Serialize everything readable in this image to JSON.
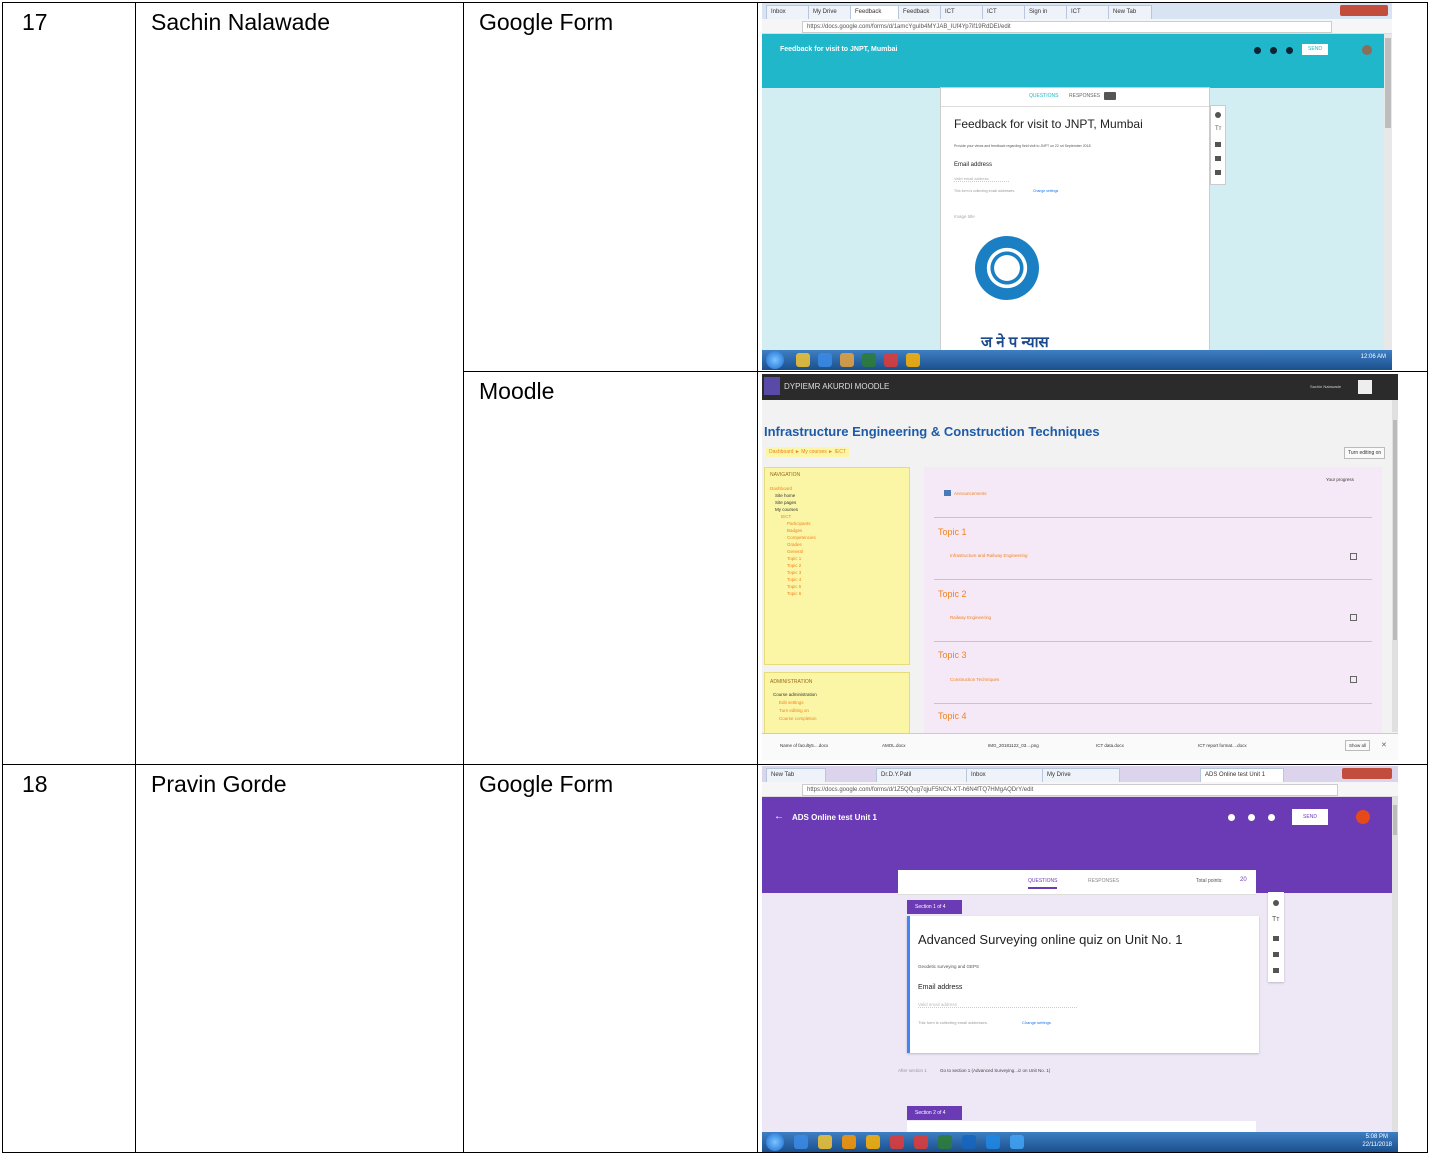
{
  "rows": [
    {
      "sr": "17",
      "name": "Sachin Nalawade",
      "tools": [
        {
          "tool": "Google Form",
          "form_title": "Feedback for visit to JNPT, Mumbai",
          "header_title": "Feedback for visit to JNPT, Mumbai",
          "tab_questions": "QUESTIONS",
          "tab_responses": "RESPONSES",
          "description": "Provide your views and feedback regarding field visit to JNPT on 22 nd September 2018",
          "field_label": "Email address",
          "field_placeholder": "Valid email address",
          "collecting_note": "This form is collecting email addresses.",
          "change_settings": "Change settings",
          "image_title": "Image title",
          "logo_text": "ज ने प न्यास",
          "send_label": "SEND",
          "url": "https://docs.google.com/forms/d/1amcYguIb4MYJAB_IUf4Yp7if19RdDEI/edit",
          "clock": "12:06 AM"
        },
        {
          "tool": "Moodle",
          "site_name": "DYPIEMR AKURDI MOODLE",
          "user_name": "Sachin Nalawade",
          "course_title": "Infrastructure Engineering & Construction Techniques",
          "breadcrumb": "Dashboard ► My courses ► IECT",
          "turn_editing": "Turn editing on",
          "your_progress": "Your progress",
          "announcements": "Announcements",
          "nav_heading": "NAVIGATION",
          "nav_items": [
            "Dashboard",
            "Site home",
            "Site pages",
            "My courses",
            "IECT",
            "Participants",
            "Badges",
            "Competencies",
            "Grades",
            "General",
            "Topic 1",
            "Topic 2",
            "Topic 3",
            "Topic 4",
            "Topic 5",
            "Topic 6"
          ],
          "admin_heading": "ADMINISTRATION",
          "admin_items": [
            "Course administration",
            "Edit settings",
            "Turn editing on",
            "Course completion"
          ],
          "topics": [
            {
              "title": "Topic 1",
              "activity": "Infrastructure and Railway Engineering"
            },
            {
              "title": "Topic 2",
              "activity": "Railway Engineering"
            },
            {
              "title": "Topic 3",
              "activity": "Construction Techniques"
            },
            {
              "title": "Topic 4",
              "activity": ""
            }
          ],
          "downloads": [
            "Name of faculty5....docx",
            "AMOL.docx",
            "IMG_20181122_03....png",
            "ICT data.docx",
            "ICT report format....docx"
          ],
          "show_all": "Show all"
        }
      ]
    },
    {
      "sr": "18",
      "name": "Pravin Gorde",
      "tools": [
        {
          "tool": "Google Form",
          "header_title": "ADS Online test Unit 1",
          "send_label": "SEND",
          "tab_questions": "QUESTIONS",
          "tab_responses": "RESPONSES",
          "total_points_label": "Total points:",
          "total_points": "20",
          "section1": "Section 1 of 4",
          "form_title": "Advanced Surveying online quiz on Unit No. 1",
          "description": "Geodetic surveying and GEPS",
          "field_label": "Email address",
          "field_placeholder": "Valid email address",
          "collecting_note": "This form is collecting email addresses.",
          "change_settings": "Change settings",
          "after_section": "After section 1",
          "goto": "Go to section 1 (Advanced Surveying...iz on Unit No. 1)",
          "section2": "Section 2 of 4",
          "url": "https://docs.google.com/forms/d/1Z5QQug7qjuF5NCN-XT-h6N4fTQ7HMgAQDrY/edit",
          "clock": "5:08 PM",
          "date": "22/11/2018"
        }
      ]
    }
  ],
  "colors": {
    "gform_teal": "#1fb7c9",
    "gform_purple": "#6a3bb5",
    "moodle_yellow": "#fbf6a6",
    "moodle_pink": "#f6e9f7",
    "moodle_orange": "#f0821e",
    "moodle_dark": "#2b2b2b",
    "moodle_title_blue": "#1d5aa8"
  }
}
